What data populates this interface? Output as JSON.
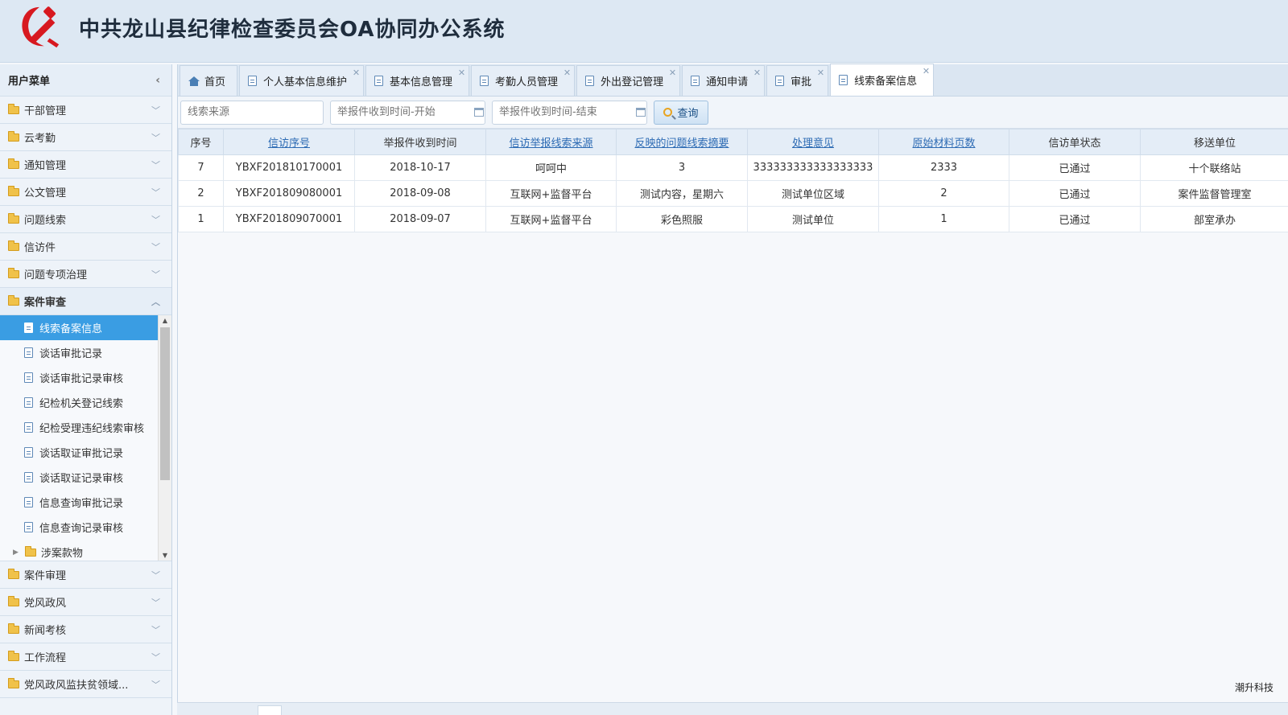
{
  "header": {
    "title": "中共龙山县纪律检查委员会OA协同办公系统"
  },
  "sidebar": {
    "title": "用户菜单",
    "groups_top": [
      {
        "label": "干部管理"
      },
      {
        "label": "云考勤"
      },
      {
        "label": "通知管理"
      },
      {
        "label": "公文管理"
      },
      {
        "label": "问题线索"
      },
      {
        "label": "信访件"
      },
      {
        "label": "问题专项治理"
      }
    ],
    "open_group": {
      "label": "案件审查"
    },
    "sub_items": [
      {
        "label": "线索备案信息"
      },
      {
        "label": "谈话审批记录"
      },
      {
        "label": "谈话审批记录审核"
      },
      {
        "label": "纪检机关登记线索"
      },
      {
        "label": "纪检受理违纪线索审核"
      },
      {
        "label": "谈话取证审批记录"
      },
      {
        "label": "谈话取证记录审核"
      },
      {
        "label": "信息查询审批记录"
      },
      {
        "label": "信息查询记录审核"
      }
    ],
    "sub_folder": {
      "label": "涉案款物"
    },
    "groups_bottom": [
      {
        "label": "案件审理"
      },
      {
        "label": "党风政风"
      },
      {
        "label": "新闻考核"
      },
      {
        "label": "工作流程"
      },
      {
        "label": "党风政风监扶贫领域..."
      }
    ]
  },
  "tabs": [
    {
      "label": "首页"
    },
    {
      "label": "个人基本信息维护"
    },
    {
      "label": "基本信息管理"
    },
    {
      "label": "考勤人员管理"
    },
    {
      "label": "外出登记管理"
    },
    {
      "label": "通知申请"
    },
    {
      "label": "审批"
    },
    {
      "label": "线索备案信息"
    }
  ],
  "toolbar": {
    "source_placeholder": "线索来源",
    "start_placeholder": "举报件收到时间-开始",
    "end_placeholder": "举报件收到时间-结束",
    "search_label": "查询"
  },
  "table": {
    "headers": [
      "序号",
      "信访序号",
      "举报件收到时间",
      "信访举报线索来源",
      "反映的问题线索摘要",
      "处理意见",
      "原始材料页数",
      "信访单状态",
      "移送单位"
    ],
    "rows": [
      [
        "7",
        "YBXF201810170001",
        "2018-10-17",
        "呵呵中",
        "3",
        "333333333333333333",
        "2333",
        "已通过",
        "十个联络站"
      ],
      [
        "2",
        "YBXF201809080001",
        "2018-09-08",
        "互联网+监督平台",
        "测试内容，星期六",
        "测试单位区域",
        "2",
        "已通过",
        "案件监督管理室"
      ],
      [
        "1",
        "YBXF201809070001",
        "2018-09-07",
        "互联网+监督平台",
        "彩色照服",
        "测试单位",
        "1",
        "已通过",
        "部室承办"
      ]
    ]
  },
  "watermark": "潮升科技"
}
